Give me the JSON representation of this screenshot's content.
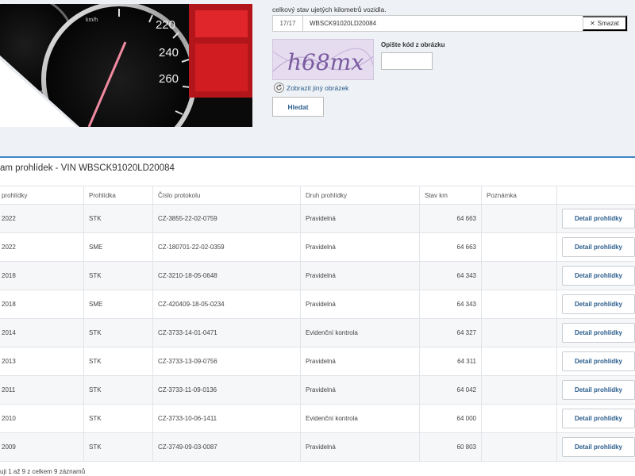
{
  "form": {
    "intro": "celkový stav ujetých kilometrů vozidla.",
    "counter": "17/17",
    "vin_value": "WBSCK91020LD20084",
    "clear_label": "Smazat",
    "captcha_text": "h68mx",
    "captcha_label": "Opište kód z obrázku",
    "captcha_value": "",
    "refresh_label": "Zobrazit jiný obrázek",
    "search_label": "Hledat"
  },
  "hero": {
    "speed_labels": [
      "220",
      "240",
      "260"
    ],
    "gauge_caption": "km/h"
  },
  "table": {
    "title": "am prohlídek - VIN WBSCK91020LD20084",
    "headers": [
      "prohlídky",
      "Prohlídka",
      "Číslo protokolu",
      "Druh prohlídky",
      "Stav km",
      "Poznámka",
      ""
    ],
    "rows": [
      {
        "date": "2022",
        "type": "STK",
        "protocol": "CZ-3855-22-02-0759",
        "kind": "Pravidelná",
        "km": "64 663",
        "note": ""
      },
      {
        "date": "2022",
        "type": "SME",
        "protocol": "CZ-180701-22-02-0359",
        "kind": "Pravidelná",
        "km": "64 663",
        "note": ""
      },
      {
        "date": "2018",
        "type": "STK",
        "protocol": "CZ-3210-18-05-0648",
        "kind": "Pravidelná",
        "km": "64 343",
        "note": ""
      },
      {
        "date": "2018",
        "type": "SME",
        "protocol": "CZ-420409-18-05-0234",
        "kind": "Pravidelná",
        "km": "64 343",
        "note": ""
      },
      {
        "date": "2014",
        "type": "STK",
        "protocol": "CZ-3733-14-01-0471",
        "kind": "Evidenční kontrola",
        "km": "64 327",
        "note": ""
      },
      {
        "date": "2013",
        "type": "STK",
        "protocol": "CZ-3733-13-09-0756",
        "kind": "Pravidelná",
        "km": "64 311",
        "note": ""
      },
      {
        "date": "2011",
        "type": "STK",
        "protocol": "CZ-3733-11-09-0136",
        "kind": "Pravidelná",
        "km": "64 042",
        "note": ""
      },
      {
        "date": "2010",
        "type": "STK",
        "protocol": "CZ-3733-10-06-1411",
        "kind": "Evidenční kontrola",
        "km": "64 000",
        "note": ""
      },
      {
        "date": "2009",
        "type": "STK",
        "protocol": "CZ-3749-09-03-0087",
        "kind": "Pravidelná",
        "km": "60 803",
        "note": ""
      }
    ],
    "detail_label": "Detail prohlídky",
    "footer": "uji 1 až 9 z celkem 9 záznamů"
  },
  "colors": {
    "accent": "#3f86c6",
    "link": "#2a5d8c",
    "top_bg": "#eef1f5",
    "gauge_red": "#e0262a"
  }
}
